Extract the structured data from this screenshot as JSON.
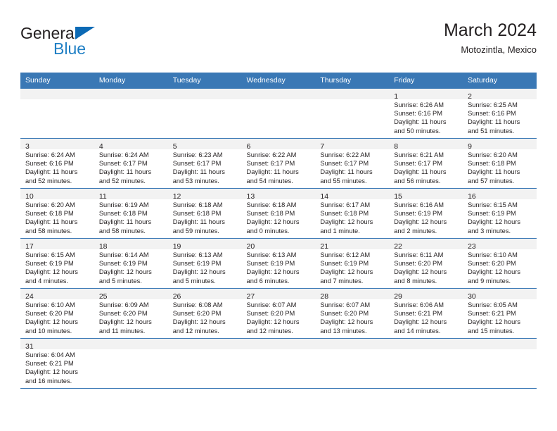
{
  "brand": {
    "word1": "General",
    "word2": "Blue",
    "triangle_color": "#0c6ab5",
    "blue_color": "#1f7fc4"
  },
  "header": {
    "title": "March 2024",
    "subtitle": "Motozintla, Mexico"
  },
  "theme": {
    "header_bg": "#3a78b5",
    "daynum_bg": "#f2f2f2",
    "border": "#3a78b5",
    "text": "#231f20"
  },
  "weekdays": [
    "Sunday",
    "Monday",
    "Tuesday",
    "Wednesday",
    "Thursday",
    "Friday",
    "Saturday"
  ],
  "weeks": [
    [
      {
        "day": "",
        "lines": []
      },
      {
        "day": "",
        "lines": []
      },
      {
        "day": "",
        "lines": []
      },
      {
        "day": "",
        "lines": []
      },
      {
        "day": "",
        "lines": []
      },
      {
        "day": "1",
        "lines": [
          "Sunrise: 6:26 AM",
          "Sunset: 6:16 PM",
          "Daylight: 11 hours",
          "and 50 minutes."
        ]
      },
      {
        "day": "2",
        "lines": [
          "Sunrise: 6:25 AM",
          "Sunset: 6:16 PM",
          "Daylight: 11 hours",
          "and 51 minutes."
        ]
      }
    ],
    [
      {
        "day": "3",
        "lines": [
          "Sunrise: 6:24 AM",
          "Sunset: 6:16 PM",
          "Daylight: 11 hours",
          "and 52 minutes."
        ]
      },
      {
        "day": "4",
        "lines": [
          "Sunrise: 6:24 AM",
          "Sunset: 6:17 PM",
          "Daylight: 11 hours",
          "and 52 minutes."
        ]
      },
      {
        "day": "5",
        "lines": [
          "Sunrise: 6:23 AM",
          "Sunset: 6:17 PM",
          "Daylight: 11 hours",
          "and 53 minutes."
        ]
      },
      {
        "day": "6",
        "lines": [
          "Sunrise: 6:22 AM",
          "Sunset: 6:17 PM",
          "Daylight: 11 hours",
          "and 54 minutes."
        ]
      },
      {
        "day": "7",
        "lines": [
          "Sunrise: 6:22 AM",
          "Sunset: 6:17 PM",
          "Daylight: 11 hours",
          "and 55 minutes."
        ]
      },
      {
        "day": "8",
        "lines": [
          "Sunrise: 6:21 AM",
          "Sunset: 6:17 PM",
          "Daylight: 11 hours",
          "and 56 minutes."
        ]
      },
      {
        "day": "9",
        "lines": [
          "Sunrise: 6:20 AM",
          "Sunset: 6:18 PM",
          "Daylight: 11 hours",
          "and 57 minutes."
        ]
      }
    ],
    [
      {
        "day": "10",
        "lines": [
          "Sunrise: 6:20 AM",
          "Sunset: 6:18 PM",
          "Daylight: 11 hours",
          "and 58 minutes."
        ]
      },
      {
        "day": "11",
        "lines": [
          "Sunrise: 6:19 AM",
          "Sunset: 6:18 PM",
          "Daylight: 11 hours",
          "and 58 minutes."
        ]
      },
      {
        "day": "12",
        "lines": [
          "Sunrise: 6:18 AM",
          "Sunset: 6:18 PM",
          "Daylight: 11 hours",
          "and 59 minutes."
        ]
      },
      {
        "day": "13",
        "lines": [
          "Sunrise: 6:18 AM",
          "Sunset: 6:18 PM",
          "Daylight: 12 hours",
          "and 0 minutes."
        ]
      },
      {
        "day": "14",
        "lines": [
          "Sunrise: 6:17 AM",
          "Sunset: 6:18 PM",
          "Daylight: 12 hours",
          "and 1 minute."
        ]
      },
      {
        "day": "15",
        "lines": [
          "Sunrise: 6:16 AM",
          "Sunset: 6:19 PM",
          "Daylight: 12 hours",
          "and 2 minutes."
        ]
      },
      {
        "day": "16",
        "lines": [
          "Sunrise: 6:15 AM",
          "Sunset: 6:19 PM",
          "Daylight: 12 hours",
          "and 3 minutes."
        ]
      }
    ],
    [
      {
        "day": "17",
        "lines": [
          "Sunrise: 6:15 AM",
          "Sunset: 6:19 PM",
          "Daylight: 12 hours",
          "and 4 minutes."
        ]
      },
      {
        "day": "18",
        "lines": [
          "Sunrise: 6:14 AM",
          "Sunset: 6:19 PM",
          "Daylight: 12 hours",
          "and 5 minutes."
        ]
      },
      {
        "day": "19",
        "lines": [
          "Sunrise: 6:13 AM",
          "Sunset: 6:19 PM",
          "Daylight: 12 hours",
          "and 5 minutes."
        ]
      },
      {
        "day": "20",
        "lines": [
          "Sunrise: 6:13 AM",
          "Sunset: 6:19 PM",
          "Daylight: 12 hours",
          "and 6 minutes."
        ]
      },
      {
        "day": "21",
        "lines": [
          "Sunrise: 6:12 AM",
          "Sunset: 6:19 PM",
          "Daylight: 12 hours",
          "and 7 minutes."
        ]
      },
      {
        "day": "22",
        "lines": [
          "Sunrise: 6:11 AM",
          "Sunset: 6:20 PM",
          "Daylight: 12 hours",
          "and 8 minutes."
        ]
      },
      {
        "day": "23",
        "lines": [
          "Sunrise: 6:10 AM",
          "Sunset: 6:20 PM",
          "Daylight: 12 hours",
          "and 9 minutes."
        ]
      }
    ],
    [
      {
        "day": "24",
        "lines": [
          "Sunrise: 6:10 AM",
          "Sunset: 6:20 PM",
          "Daylight: 12 hours",
          "and 10 minutes."
        ]
      },
      {
        "day": "25",
        "lines": [
          "Sunrise: 6:09 AM",
          "Sunset: 6:20 PM",
          "Daylight: 12 hours",
          "and 11 minutes."
        ]
      },
      {
        "day": "26",
        "lines": [
          "Sunrise: 6:08 AM",
          "Sunset: 6:20 PM",
          "Daylight: 12 hours",
          "and 12 minutes."
        ]
      },
      {
        "day": "27",
        "lines": [
          "Sunrise: 6:07 AM",
          "Sunset: 6:20 PM",
          "Daylight: 12 hours",
          "and 12 minutes."
        ]
      },
      {
        "day": "28",
        "lines": [
          "Sunrise: 6:07 AM",
          "Sunset: 6:20 PM",
          "Daylight: 12 hours",
          "and 13 minutes."
        ]
      },
      {
        "day": "29",
        "lines": [
          "Sunrise: 6:06 AM",
          "Sunset: 6:21 PM",
          "Daylight: 12 hours",
          "and 14 minutes."
        ]
      },
      {
        "day": "30",
        "lines": [
          "Sunrise: 6:05 AM",
          "Sunset: 6:21 PM",
          "Daylight: 12 hours",
          "and 15 minutes."
        ]
      }
    ],
    [
      {
        "day": "31",
        "lines": [
          "Sunrise: 6:04 AM",
          "Sunset: 6:21 PM",
          "Daylight: 12 hours",
          "and 16 minutes."
        ]
      },
      {
        "day": "",
        "lines": []
      },
      {
        "day": "",
        "lines": []
      },
      {
        "day": "",
        "lines": []
      },
      {
        "day": "",
        "lines": []
      },
      {
        "day": "",
        "lines": []
      },
      {
        "day": "",
        "lines": []
      }
    ]
  ]
}
